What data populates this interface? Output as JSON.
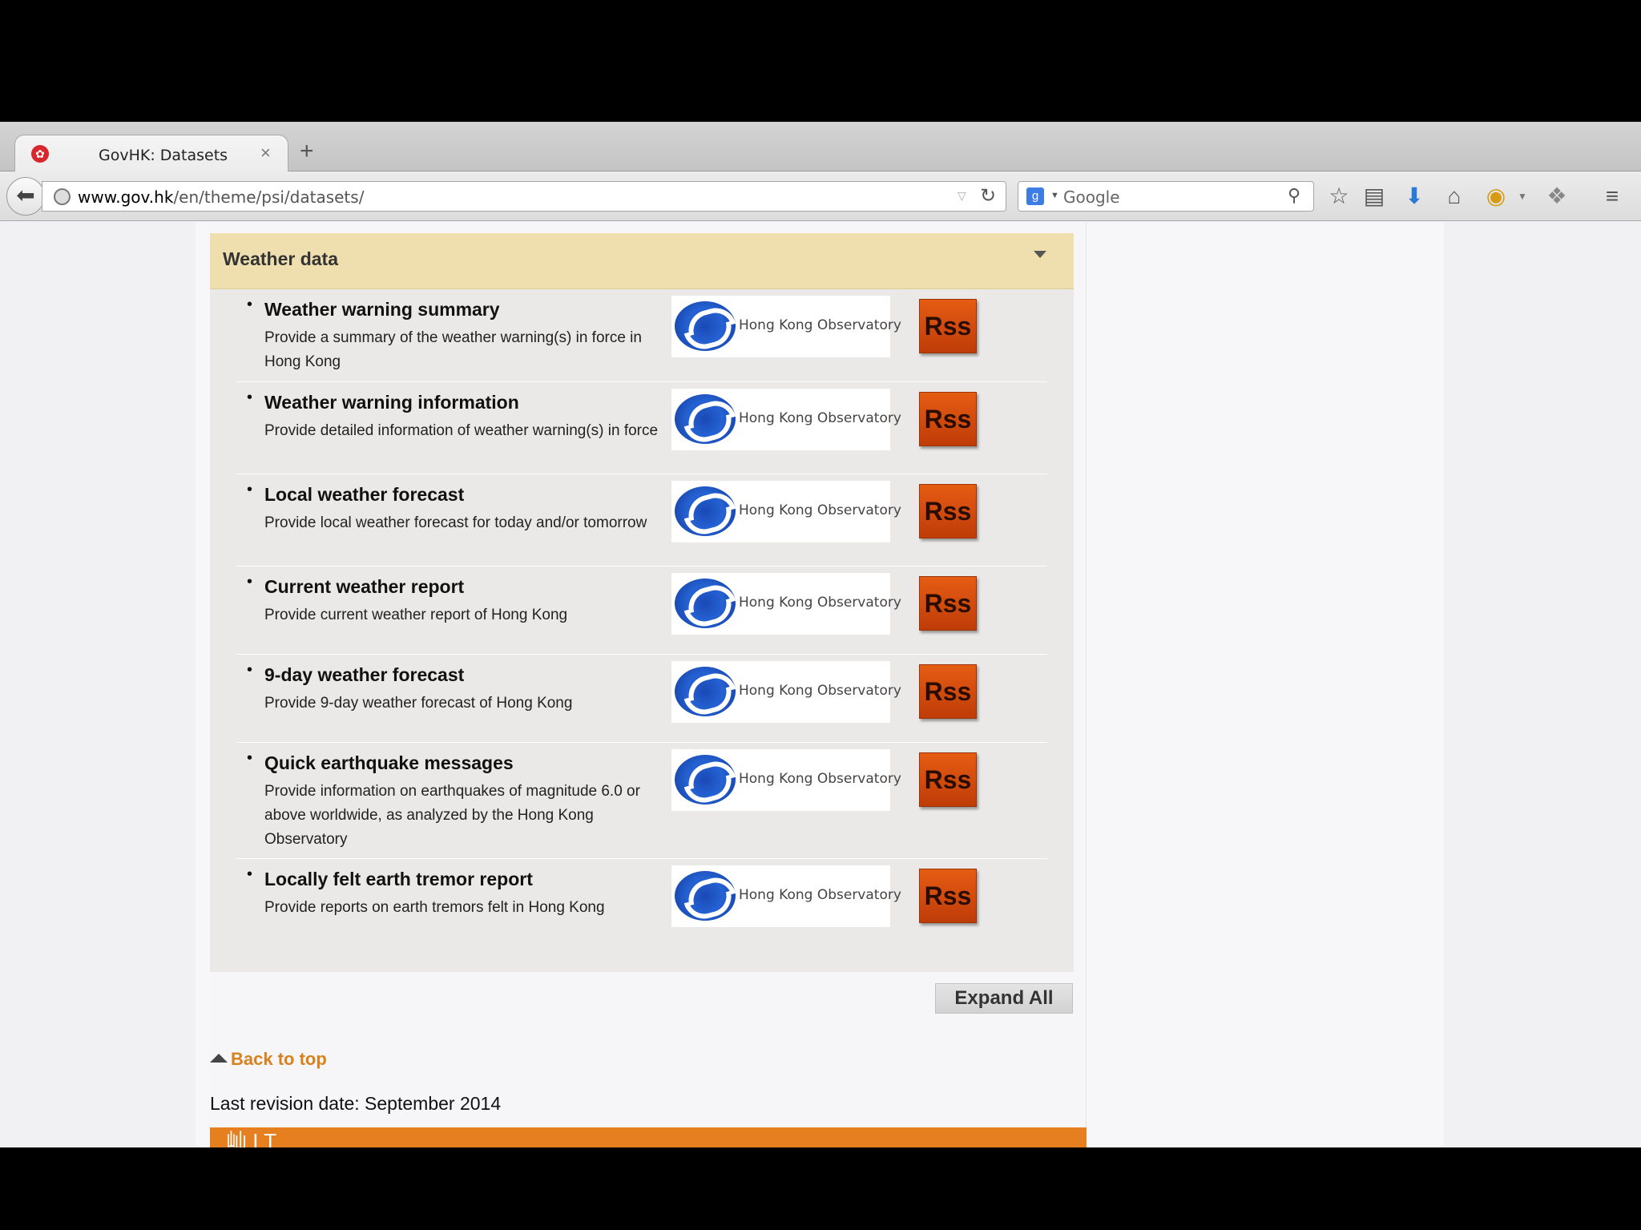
{
  "browser": {
    "tab_title": "GovHK: Datasets",
    "tab_close": "×",
    "new_tab": "+",
    "url_host": "www.gov.hk",
    "url_path": "/en/theme/psi/datasets/",
    "search_placeholder": "Google",
    "icons": [
      "back-arrow-icon",
      "globe-icon",
      "reload-icon",
      "search-icon",
      "bookmark-star-icon",
      "bookmarks-list-icon",
      "downloads-icon",
      "home-icon",
      "addon-icon",
      "menu-icon"
    ]
  },
  "section": {
    "title": "Weather data",
    "provider": "Hong Kong Observatory",
    "rss_label": "Rss",
    "items": [
      {
        "title": "Weather warning summary",
        "desc": "Provide a summary of the weather warning(s) in force in Hong Kong"
      },
      {
        "title": "Weather warning information",
        "desc": "Provide detailed information of weather warning(s) in force"
      },
      {
        "title": "Local weather forecast",
        "desc": "Provide local weather forecast for today and/or tomorrow"
      },
      {
        "title": "Current weather report",
        "desc": "Provide current weather report of Hong Kong"
      },
      {
        "title": "9-day weather forecast",
        "desc": "Provide 9-day weather forecast of Hong Kong"
      },
      {
        "title": "Quick earthquake messages",
        "desc": "Provide information on earthquakes of magnitude 6.0 or above worldwide, as analyzed by the Hong Kong Observatory"
      },
      {
        "title": "Locally felt earth tremor report",
        "desc": "Provide reports on earth tremors felt in Hong Kong"
      }
    ]
  },
  "actions": {
    "expand_all": "Expand All",
    "back_to_top": "Back to top"
  },
  "footer": {
    "last_revision": "Last revision date: September 2014"
  },
  "colors": {
    "accordion_header": "#f0dfae",
    "rss": "#d4500d",
    "link": "#d8821e",
    "footer_band": "#e57f1f"
  }
}
